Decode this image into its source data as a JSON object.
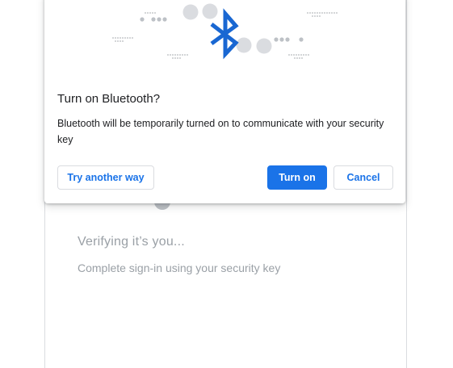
{
  "dialog": {
    "title": "Turn on Bluetooth?",
    "body": "Bluetooth will be temporarily turned on to communicate with your security key",
    "illustration_icon": "bluetooth-icon",
    "buttons": {
      "try_another_way": "Try another way",
      "turn_on": "Turn on",
      "cancel": "Cancel"
    },
    "colors": {
      "accent": "#1a73e8",
      "text": "#202124",
      "border": "#dadce0"
    }
  },
  "background_page": {
    "heading": "Verifying it’s you...",
    "subtitle": "Complete sign-in using your security key",
    "colors": {
      "muted_text": "#9aa0a6"
    }
  }
}
